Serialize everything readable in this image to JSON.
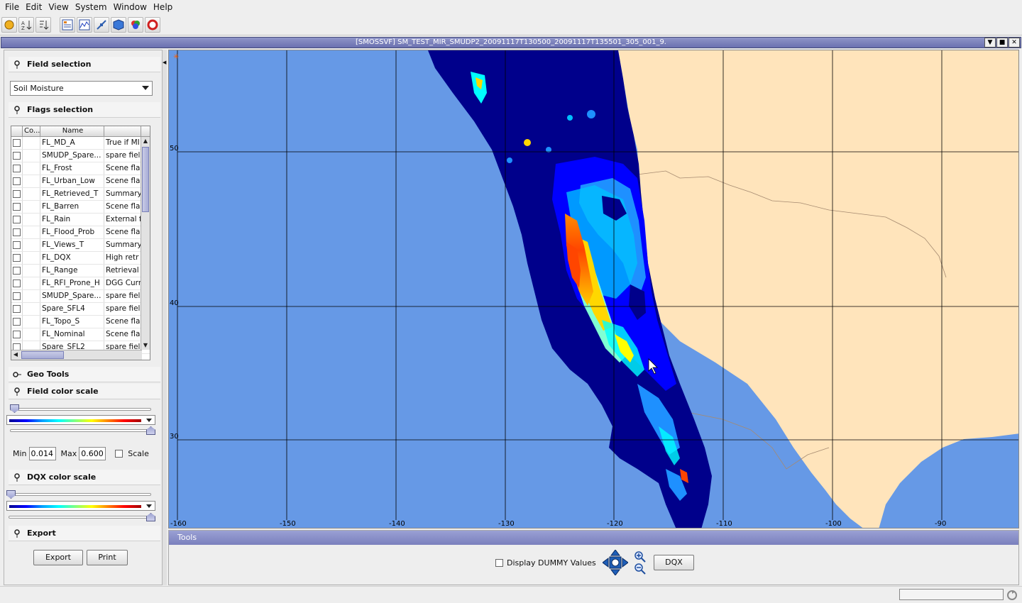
{
  "menu": [
    "File",
    "Edit",
    "View",
    "System",
    "Window",
    "Help"
  ],
  "toolbar_icons": [
    "open-icon",
    "sort-ascending-icon",
    "sort-descending-icon",
    "table-view-icon",
    "chart-view-icon",
    "satellite-icon",
    "cube-icon",
    "color-circles-icon",
    "lifebuoy-icon"
  ],
  "window": {
    "title": "[SMOSSVF]  SM_TEST_MIR_SMUDP2_20091117T130500_20091117T135501_305_001_9."
  },
  "left": {
    "field_selection": {
      "title": "Field selection",
      "value": "Soil Moisture"
    },
    "flags_selection": {
      "title": "Flags selection",
      "columns": [
        "Co...",
        "Name",
        ""
      ],
      "rows": [
        {
          "name": "FL_MD_A",
          "desc": "True if MI"
        },
        {
          "name": "SMUDP_Spare...",
          "desc": "spare field"
        },
        {
          "name": "FL_Frost",
          "desc": "Scene flag"
        },
        {
          "name": "FL_Urban_Low",
          "desc": "Scene flag"
        },
        {
          "name": "FL_Retrieved_T",
          "desc": "Summary"
        },
        {
          "name": "FL_Barren",
          "desc": "Scene flag"
        },
        {
          "name": "FL_Rain",
          "desc": "External f"
        },
        {
          "name": "FL_Flood_Prob",
          "desc": "Scene flag"
        },
        {
          "name": "FL_Views_T",
          "desc": "Summary"
        },
        {
          "name": "FL_DQX",
          "desc": "High retr"
        },
        {
          "name": "FL_Range",
          "desc": "Retrieval"
        },
        {
          "name": "FL_RFI_Prone_H",
          "desc": "DGG Curr"
        },
        {
          "name": "SMUDP_Spare...",
          "desc": "spare field"
        },
        {
          "name": "Spare_SFL4",
          "desc": "spare field"
        },
        {
          "name": "FL_Topo_S",
          "desc": "Scene flag"
        },
        {
          "name": "FL_Nominal",
          "desc": "Scene flag"
        },
        {
          "name": "Spare_SFL2",
          "desc": "spare field"
        }
      ]
    },
    "geo_tools": "Geo Tools",
    "field_color_scale": {
      "title": "Field color scale",
      "min_label": "Min",
      "min": "0.014",
      "max_label": "Max",
      "max": "0.600",
      "scale_label": "Scale"
    },
    "dqx_color_scale": {
      "title": "DQX color scale"
    },
    "export": {
      "title": "Export",
      "export_btn": "Export",
      "print_btn": "Print"
    }
  },
  "map": {
    "lat_labels": [
      "50",
      "40",
      "30"
    ],
    "lon_labels": [
      "-160",
      "-150",
      "-140",
      "-130",
      "-120",
      "-110",
      "-100",
      "-90"
    ],
    "colors": {
      "ocean": "#6699e6",
      "land": "#ffe4bb",
      "low": "#00008b",
      "grid": "#000000"
    }
  },
  "tools": {
    "title": "Tools",
    "dummy_label": "Display DUMMY Values",
    "dqx_btn": "DQX"
  }
}
